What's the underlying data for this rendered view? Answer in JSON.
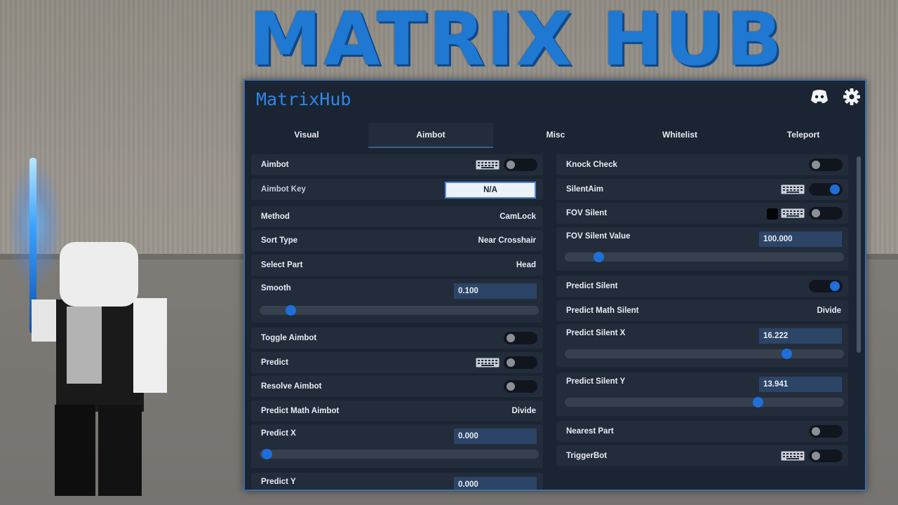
{
  "banner": {
    "title": "MATRIX HUB"
  },
  "window": {
    "title": "MatrixHub",
    "icons": {
      "discord": "discord-icon",
      "settings": "gear-icon"
    }
  },
  "tabs": [
    {
      "label": "Visual",
      "active": false
    },
    {
      "label": "Aimbot",
      "active": true
    },
    {
      "label": "Misc",
      "active": false
    },
    {
      "label": "Whitelist",
      "active": false
    },
    {
      "label": "Teleport",
      "active": false
    }
  ],
  "left": {
    "aimbot": {
      "label": "Aimbot",
      "enabled": false
    },
    "aimbot_key": {
      "label": "Aimbot Key",
      "value": "N/A"
    },
    "method": {
      "label": "Method",
      "value": "CamLock"
    },
    "sort_type": {
      "label": "Sort Type",
      "value": "Near Crosshair"
    },
    "select_part": {
      "label": "Select Part",
      "value": "Head"
    },
    "smooth": {
      "label": "Smooth",
      "value": "0.100",
      "fraction": 0.09
    },
    "toggle_aimbot": {
      "label": "Toggle Aimbot",
      "enabled": false
    },
    "predict": {
      "label": "Predict",
      "enabled": false
    },
    "resolve_aimbot": {
      "label": "Resolve Aimbot",
      "enabled": false
    },
    "predict_math_aimbot": {
      "label": "Predict Math Aimbot",
      "value": "Divide"
    },
    "predict_x": {
      "label": "Predict X",
      "value": "0.000",
      "fraction": 0.0
    },
    "predict_y": {
      "label": "Predict Y",
      "value": "0.000"
    }
  },
  "right": {
    "knock_check": {
      "label": "Knock Check",
      "enabled": false
    },
    "silent_aim": {
      "label": "SilentAim",
      "enabled": true
    },
    "fov_silent": {
      "label": "FOV Silent",
      "enabled": false,
      "color": "#050505"
    },
    "fov_silent_value": {
      "label": "FOV Silent Value",
      "value": "100.000",
      "fraction": 0.1
    },
    "predict_silent": {
      "label": "Predict Silent",
      "enabled": true
    },
    "predict_math_silent": {
      "label": "Predict Math Silent",
      "value": "Divide"
    },
    "predict_silent_x": {
      "label": "Predict Silent X",
      "value": "16.222",
      "fraction": 0.81
    },
    "predict_silent_y": {
      "label": "Predict Silent Y",
      "value": "13.941",
      "fraction": 0.7
    },
    "nearest_part": {
      "label": "Nearest Part",
      "enabled": false
    },
    "trigger_bot": {
      "label": "TriggerBot",
      "enabled": false
    }
  },
  "colors": {
    "accent": "#1e6fd9",
    "panel_bg": "#1b2432",
    "row_bg": "#222c3b",
    "banner": "#1f78d1"
  }
}
